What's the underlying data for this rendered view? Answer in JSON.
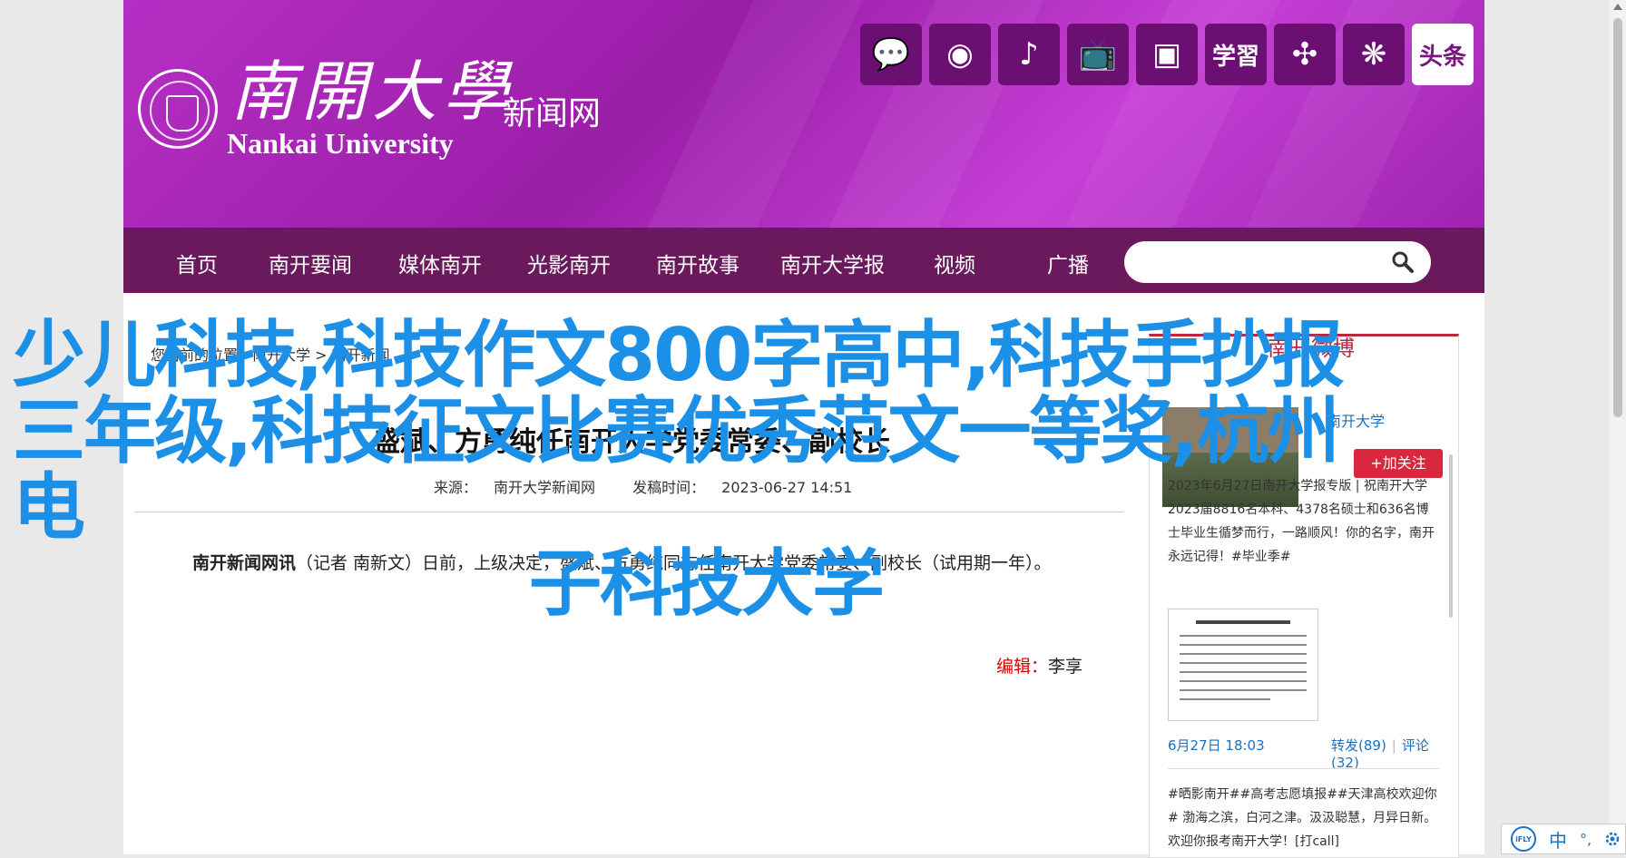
{
  "header": {
    "logo_cn": "南開大學",
    "logo_en": "Nankai University",
    "site_name": "新闻网",
    "social": [
      {
        "name": "wechat-icon",
        "glyph": "💬",
        "style": "dark"
      },
      {
        "name": "weibo-icon",
        "glyph": "◉",
        "style": "dark"
      },
      {
        "name": "douyin-icon",
        "glyph": "♪",
        "style": "dark"
      },
      {
        "name": "bilibili-icon",
        "glyph": "📺",
        "style": "dark"
      },
      {
        "name": "kuaishou-icon",
        "glyph": "▣",
        "style": "dark"
      },
      {
        "name": "xuexi-icon",
        "glyph": "学習",
        "style": "dark"
      },
      {
        "name": "app-icon",
        "glyph": "✣",
        "style": "dark"
      },
      {
        "name": "dandelion-icon",
        "glyph": "❋",
        "style": "dark"
      },
      {
        "name": "toutiao-icon",
        "glyph": "头条",
        "style": "light"
      }
    ]
  },
  "nav": {
    "items": [
      "首页",
      "南开要闻",
      "媒体南开",
      "光影南开",
      "南开故事",
      "南开大学报",
      "视频",
      "广播"
    ],
    "search_placeholder": ""
  },
  "breadcrumb": {
    "text": "您当前的位置：南开大学 > 南开新闻"
  },
  "article": {
    "title": "盛斌、方勇纯任南开大学党委常委、副校长",
    "source_label": "来源：",
    "source": "南开大学新闻网",
    "date_label": "发稿时间：",
    "date": "2023-06-27 14:51",
    "lead_bold": "南开新闻网讯",
    "lead_text": "（记者 南新文）日前，上级决定，盛斌、方勇纯同志任南开大学党委常委、副校长（试用期一年）。",
    "editor_label": "编辑：",
    "editor_name": "李享"
  },
  "sidebar": {
    "tab": "南开微博",
    "account": "南开大学",
    "follow": "加关注",
    "add_button": "+加关注",
    "post1": "2023年6月27日南开大学报专版 | 祝南开大学2023届8816名本科、4378名硕士和636名博士毕业生循梦而行，一路顺风！你的名字，南开永远记得！#毕业季#",
    "post1_time": "6月27日 18:03",
    "post1_repost": "转发(89)",
    "post1_comment": "评论(32)",
    "post2": "#晒影南开##高考志愿填报##天津高校欢迎你# 渤海之滨，白河之津。汲汲聪慧，月异日新。欢迎你报考南开大学！[打call]"
  },
  "overlay": {
    "line1": "少儿科技,科技作文800字高中,科技手抄报",
    "line2": "三年级,科技征文比赛优秀范文一等奖,杭州电",
    "line3": "子科技大学"
  },
  "ime": {
    "brand": "iFLY",
    "mode": "中",
    "punct": "°,"
  },
  "colors": {
    "banner": "#a828b8",
    "nav": "#6a1a5c",
    "overlay_text": "#1c8fe6",
    "accent_red": "#d9273d",
    "link_blue": "#1b6fc2"
  }
}
